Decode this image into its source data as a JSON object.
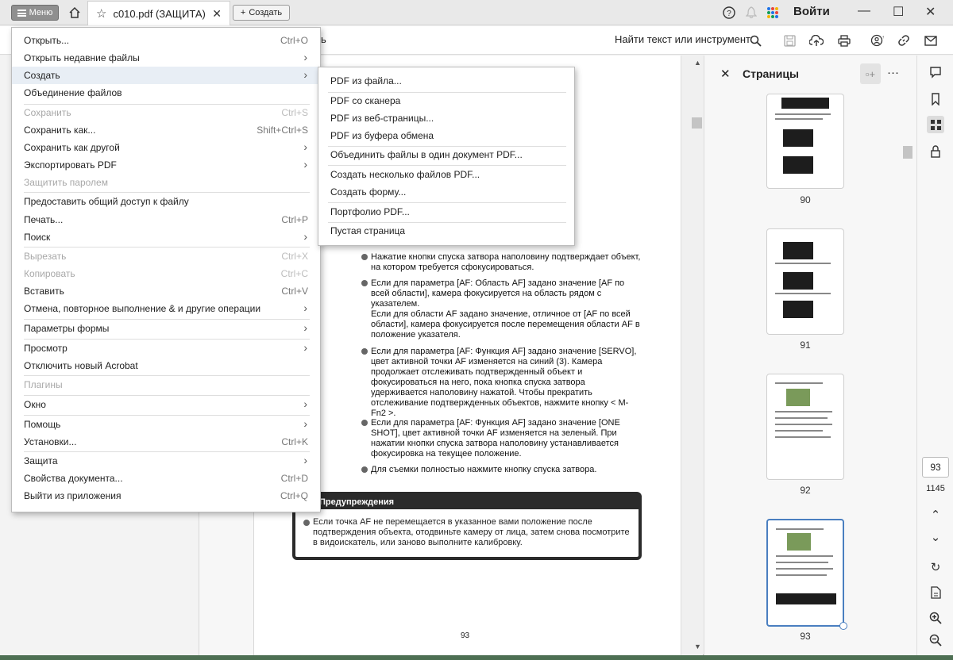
{
  "titlebar": {
    "menu_label": "Меню",
    "tab_title": "c010.pdf (ЗАЩИТА)",
    "create_label": "Создать",
    "login_label": "Войти"
  },
  "toolbar": {
    "find_label": "Найти текст или инструмент",
    "partial_label": "ь"
  },
  "menu": {
    "items": [
      {
        "label": "Открыть...",
        "shortcut": "Ctrl+O",
        "arrow": "",
        "disabled": false
      },
      {
        "label": "Открыть недавние файлы",
        "shortcut": "",
        "arrow": "›",
        "disabled": false
      },
      {
        "label": "Создать",
        "shortcut": "",
        "arrow": "›",
        "disabled": false
      },
      {
        "label": "Объединение файлов",
        "shortcut": "",
        "arrow": "",
        "disabled": false
      },
      {
        "label": "Сохранить",
        "shortcut": "Ctrl+S",
        "arrow": "",
        "disabled": true
      },
      {
        "label": "Сохранить как...",
        "shortcut": "Shift+Ctrl+S",
        "arrow": "",
        "disabled": false
      },
      {
        "label": "Сохранить как другой",
        "shortcut": "",
        "arrow": "›",
        "disabled": false
      },
      {
        "label": "Экспортировать PDF",
        "shortcut": "",
        "arrow": "›",
        "disabled": false
      },
      {
        "label": "Защитить паролем",
        "shortcut": "",
        "arrow": "",
        "disabled": true
      },
      {
        "label": "Предоставить общий доступ к файлу",
        "shortcut": "",
        "arrow": "",
        "disabled": false
      },
      {
        "label": "Печать...",
        "shortcut": "Ctrl+P",
        "arrow": "",
        "disabled": false
      },
      {
        "label": "Поиск",
        "shortcut": "",
        "arrow": "›",
        "disabled": false
      },
      {
        "label": "Вырезать",
        "shortcut": "Ctrl+X",
        "arrow": "",
        "disabled": true
      },
      {
        "label": "Копировать",
        "shortcut": "Ctrl+C",
        "arrow": "",
        "disabled": true
      },
      {
        "label": "Вставить",
        "shortcut": "Ctrl+V",
        "arrow": "",
        "disabled": false
      },
      {
        "label": "Отмена, повторное выполнение & и другие операции",
        "shortcut": "",
        "arrow": "›",
        "disabled": false
      },
      {
        "label": "Параметры формы",
        "shortcut": "",
        "arrow": "›",
        "disabled": false
      },
      {
        "label": "Просмотр",
        "shortcut": "",
        "arrow": "›",
        "disabled": false
      },
      {
        "label": "Отключить новый Acrobat",
        "shortcut": "",
        "arrow": "",
        "disabled": false
      },
      {
        "label": "Плагины",
        "shortcut": "",
        "arrow": "",
        "disabled": true
      },
      {
        "label": "Окно",
        "shortcut": "",
        "arrow": "›",
        "disabled": false
      },
      {
        "label": "Помощь",
        "shortcut": "",
        "arrow": "›",
        "disabled": false
      },
      {
        "label": "Установки...",
        "shortcut": "Ctrl+K",
        "arrow": "",
        "disabled": false
      },
      {
        "label": "Защита",
        "shortcut": "",
        "arrow": "›",
        "disabled": false
      },
      {
        "label": "Свойства документа...",
        "shortcut": "Ctrl+D",
        "arrow": "",
        "disabled": false
      },
      {
        "label": "Выйти из приложения",
        "shortcut": "Ctrl+Q",
        "arrow": "",
        "disabled": false
      }
    ]
  },
  "submenu": {
    "items": [
      "PDF из файла...",
      "PDF со сканера",
      "PDF из веб-страницы...",
      "PDF из буфера обмена",
      "Объединить файлы в один документ PDF...",
      "Создать несколько файлов PDF...",
      "Создать форму...",
      "Портфолио PDF...",
      "Пустая страница"
    ]
  },
  "document": {
    "bullets": [
      "Нажатие кнопки спуска затвора наполовину подтверждает объект, на котором требуется сфокусироваться.",
      "Если для параметра [AF: Область AF] задано значение [AF по всей области], камера фокусируется на область рядом с указателем.",
      "Если для области AF задано значение, отличное от [AF по всей области], камера фокусируется после перемещения области AF в положение указателя.",
      "Если для параметра [AF: Функция AF] задано значение [SERVO], цвет активной точки AF изменяется на синий (3). Камера продолжает отслеживать подтвержденный объект и фокусироваться на него, пока кнопка спуска затвора удерживается наполовину нажатой. Чтобы прекратить отслеживание подтвержденных объектов, нажмите кнопку < M-Fn2 >.",
      "Если для параметра [AF: Функция AF] задано значение [ONE SHOT], цвет активной точки AF изменяется на зеленый. При нажатии кнопки спуска затвора наполовину устанавливается фокусировка на текущее положение.",
      "Для съемки полностью нажмите кнопку спуска затвора."
    ],
    "warning_title": "Предупреждения",
    "warning_text": "Если точка AF не перемещается в указанное вами положение после подтверждения объекта, отодвиньте камеру от лица, затем снова посмотрите в видоискатель, или заново выполните калибровку.",
    "page_number": "93"
  },
  "pages_panel": {
    "title": "Страницы",
    "thumb_labels": [
      "90",
      "91",
      "92",
      "93"
    ]
  },
  "nav": {
    "current_page": "93",
    "total_pages": "1145"
  }
}
